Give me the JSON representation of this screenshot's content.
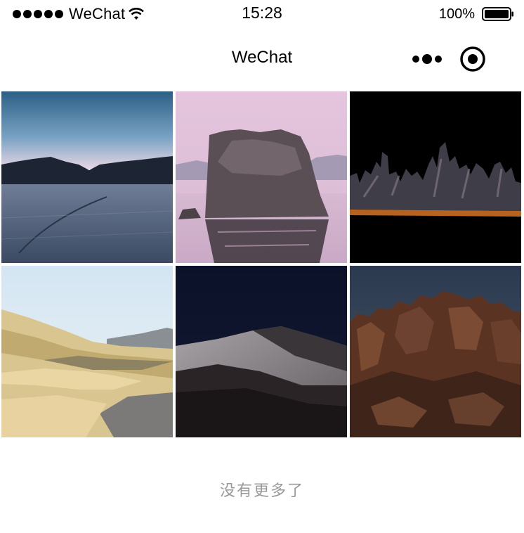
{
  "status_bar": {
    "carrier": "WeChat",
    "time": "15:28",
    "battery": "100%",
    "signal_icon": "signal-dots-icon",
    "wifi_icon": "wifi-icon",
    "battery_icon": "battery-icon"
  },
  "nav": {
    "title": "WeChat",
    "more_icon": "more-dots-icon",
    "close_icon": "target-close-icon"
  },
  "gallery": {
    "images": [
      {
        "name": "lake-dusk-wallpaper"
      },
      {
        "name": "mono-lake-rock-wallpaper"
      },
      {
        "name": "tufa-night-wallpaper"
      },
      {
        "name": "desert-dunes-day-wallpaper"
      },
      {
        "name": "desert-dune-night-wallpaper"
      },
      {
        "name": "rock-formation-night-wallpaper"
      }
    ]
  },
  "footer": {
    "text": "没有更多了"
  }
}
